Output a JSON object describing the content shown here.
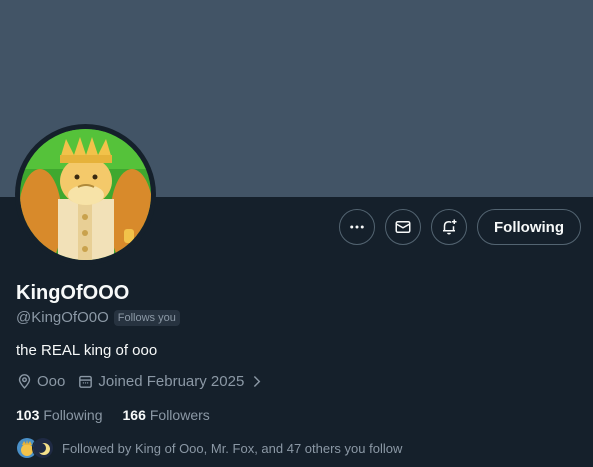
{
  "profile": {
    "display_name": "KingOfOOO",
    "handle": "@KingOfO0O",
    "follows_you_badge": "Follows you",
    "bio": "the REAL king of ooo",
    "location": "Ooo",
    "joined": "Joined February 2025"
  },
  "stats": {
    "following_count": "103",
    "following_label": "Following",
    "followers_count": "166",
    "followers_label": "Followers"
  },
  "actions": {
    "following_button": "Following"
  },
  "followed_by": {
    "text": "Followed by King of Ooo, Mr. Fox, and 47 others you follow"
  },
  "icons": {
    "more": "more-icon",
    "message": "envelope-icon",
    "notify": "bell-plus-icon",
    "location": "location-pin-icon",
    "calendar": "calendar-icon",
    "chevron": "chevron-right-icon"
  },
  "colors": {
    "background": "#15202b",
    "banner": "#425466",
    "text_primary": "#f7f9f9",
    "text_secondary": "#8b98a5",
    "border": "#536471"
  }
}
